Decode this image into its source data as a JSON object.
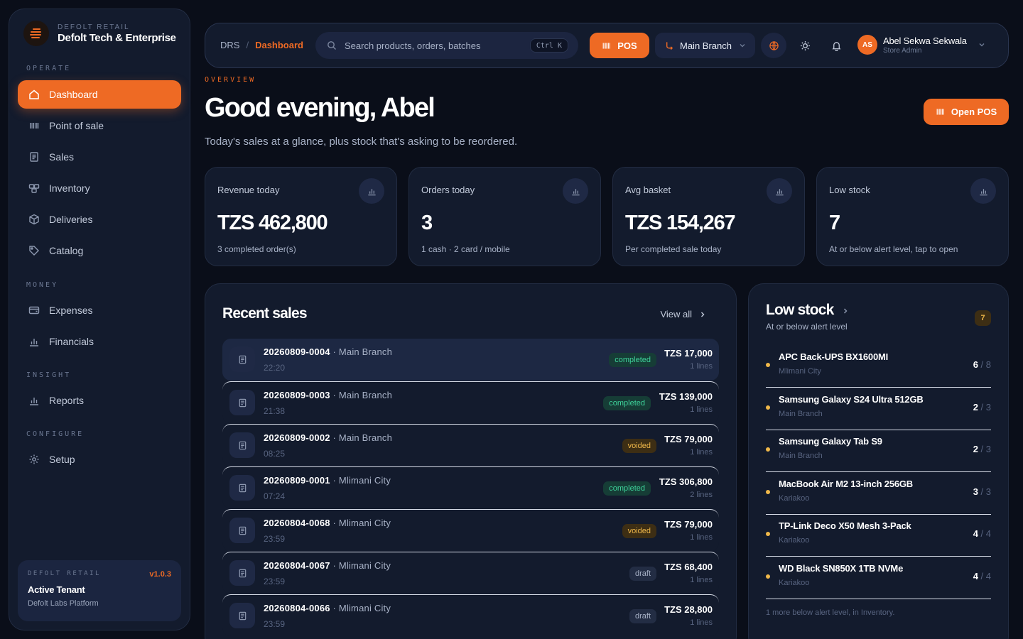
{
  "brand": {
    "kicker": "DEFOLT RETAIL",
    "name": "Defolt Tech & Enterprise"
  },
  "sidebar": {
    "sections": {
      "operate": "OPERATE",
      "money": "MONEY",
      "insight": "INSIGHT",
      "configure": "CONFIGURE"
    },
    "items": {
      "dashboard": "Dashboard",
      "pos": "Point of sale",
      "sales": "Sales",
      "inventory": "Inventory",
      "deliveries": "Deliveries",
      "catalog": "Catalog",
      "expenses": "Expenses",
      "financials": "Financials",
      "reports": "Reports",
      "setup": "Setup"
    },
    "tenant": {
      "kicker": "DEFOLT RETAIL",
      "version": "v1.0.3",
      "title": "Active Tenant",
      "platform": "Defolt Labs Platform"
    }
  },
  "topbar": {
    "breadcrumb": {
      "root": "DRS",
      "sep": "/",
      "current": "Dashboard"
    },
    "search": {
      "placeholder": "Search products, orders, batches",
      "shortcut": "Ctrl K"
    },
    "pos_label": "POS",
    "branch": "Main Branch",
    "user": {
      "initials": "AS",
      "name": "Abel Sekwa Sekwala",
      "role": "Store Admin"
    }
  },
  "header": {
    "kicker": "OVERVIEW",
    "greeting": "Good evening, Abel",
    "subtitle": "Today's sales at a glance, plus stock that's asking to be reordered.",
    "open_pos": "Open POS"
  },
  "stats": [
    {
      "label": "Revenue today",
      "value": "TZS 462,800",
      "note": "3 completed order(s)"
    },
    {
      "label": "Orders today",
      "value": "3",
      "note": "1 cash · 2 card / mobile"
    },
    {
      "label": "Avg basket",
      "value": "TZS 154,267",
      "note": "Per completed sale today"
    },
    {
      "label": "Low stock",
      "value": "7",
      "note": "At or below alert level, tap to open"
    }
  ],
  "recent_sales": {
    "title": "Recent sales",
    "view_all": "View all",
    "rows": [
      {
        "id": "20260809-0004",
        "branch": " · Main Branch",
        "time": "22:20",
        "status": "completed",
        "amount": "TZS 17,000",
        "lines": "1 lines"
      },
      {
        "id": "20260809-0003",
        "branch": " · Main Branch",
        "time": "21:38",
        "status": "completed",
        "amount": "TZS 139,000",
        "lines": "1 lines"
      },
      {
        "id": "20260809-0002",
        "branch": " · Main Branch",
        "time": "08:25",
        "status": "voided",
        "amount": "TZS 79,000",
        "lines": "1 lines"
      },
      {
        "id": "20260809-0001",
        "branch": " · Mlimani City",
        "time": "07:24",
        "status": "completed",
        "amount": "TZS 306,800",
        "lines": "2 lines"
      },
      {
        "id": "20260804-0068",
        "branch": " · Mlimani City",
        "time": "23:59",
        "status": "voided",
        "amount": "TZS 79,000",
        "lines": "1 lines"
      },
      {
        "id": "20260804-0067",
        "branch": " · Mlimani City",
        "time": "23:59",
        "status": "draft",
        "amount": "TZS 68,400",
        "lines": "1 lines"
      },
      {
        "id": "20260804-0066",
        "branch": " · Mlimani City",
        "time": "23:59",
        "status": "draft",
        "amount": "TZS 28,800",
        "lines": "1 lines"
      }
    ]
  },
  "low_stock": {
    "title": "Low stock",
    "subtitle": "At or below alert level",
    "count": "7",
    "items": [
      {
        "name": "APC Back-UPS BX1600MI",
        "location": "Mlimani City",
        "qty": "6",
        "sep": " / ",
        "alert": "8"
      },
      {
        "name": "Samsung Galaxy S24 Ultra 512GB",
        "location": "Main Branch",
        "qty": "2",
        "sep": " / ",
        "alert": "3"
      },
      {
        "name": "Samsung Galaxy Tab S9",
        "location": "Main Branch",
        "qty": "2",
        "sep": " / ",
        "alert": "3"
      },
      {
        "name": "MacBook Air M2 13-inch 256GB",
        "location": "Kariakoo",
        "qty": "3",
        "sep": " / ",
        "alert": "3"
      },
      {
        "name": "TP-Link Deco X50 Mesh 3-Pack",
        "location": "Kariakoo",
        "qty": "4",
        "sep": " / ",
        "alert": "4"
      },
      {
        "name": "WD Black SN850X 1TB NVMe",
        "location": "Kariakoo",
        "qty": "4",
        "sep": " / ",
        "alert": "4"
      }
    ],
    "more": "1 more below alert level, in Inventory."
  },
  "colors": {
    "accent": "#ee6a24",
    "background": "#0a0e19",
    "panel": "#131b2d",
    "completed": "#3ed29a",
    "voided": "#f0b84a"
  }
}
